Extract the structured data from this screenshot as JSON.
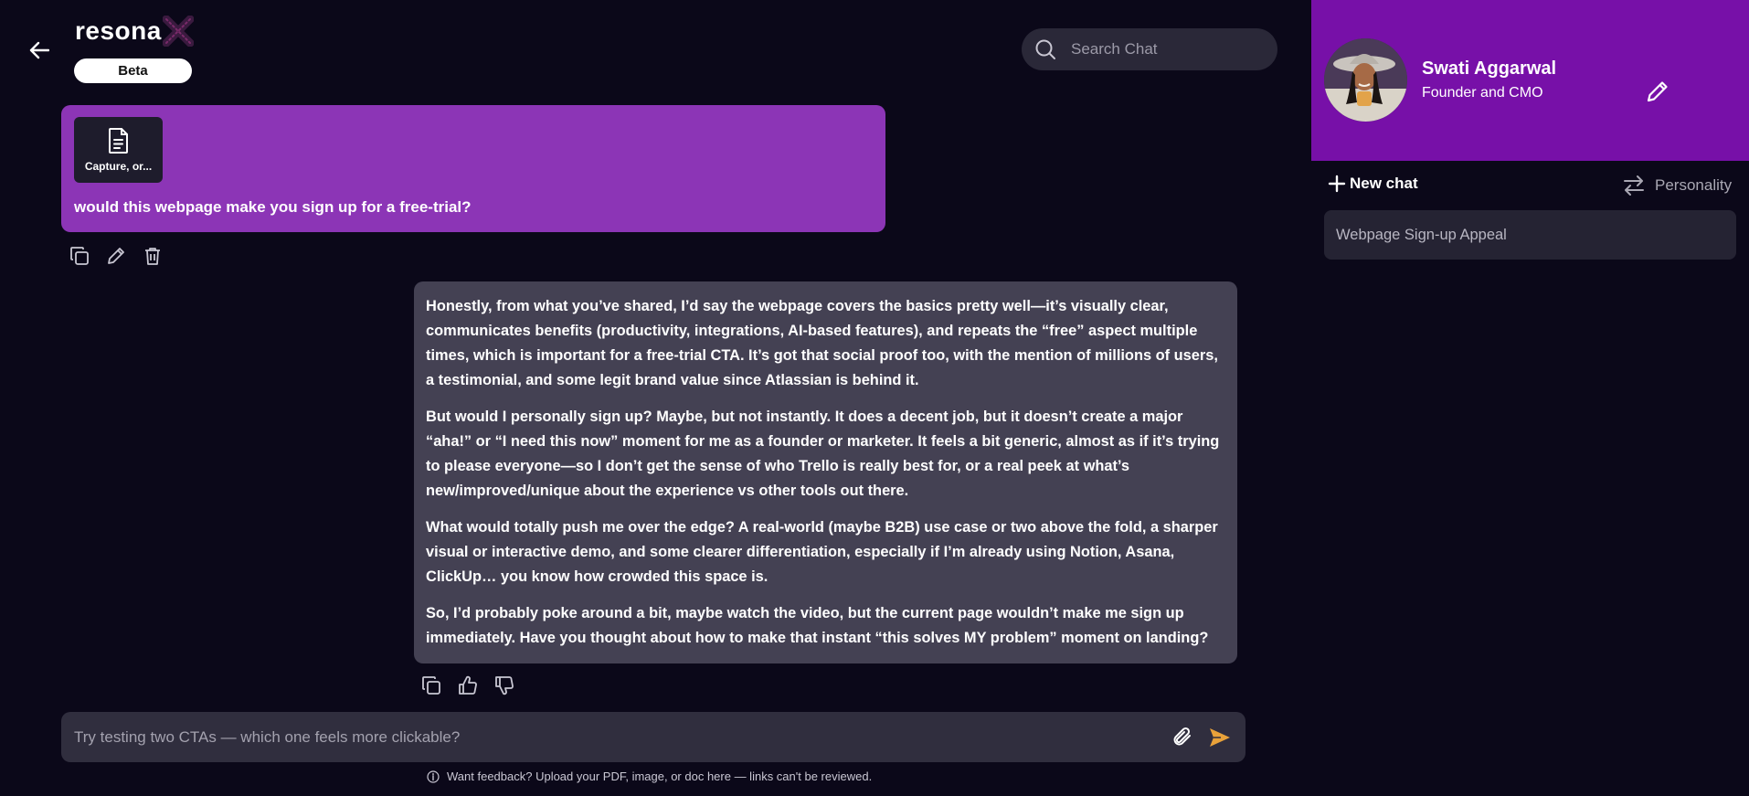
{
  "header": {
    "logo_text": "resona",
    "beta_label": "Beta",
    "search_placeholder": "Search Chat"
  },
  "user_message": {
    "attachment_name": "Capture, or...",
    "text": "would this webpage make you sign up for a free-trial?"
  },
  "ai_message": {
    "paragraphs": [
      "Honestly, from what you’ve shared, I’d say the webpage covers the basics pretty well—it’s visually clear, communicates benefits (productivity, integrations, AI-based features), and repeats the “free” aspect multiple times, which is important for a free-trial CTA. It’s got that social proof too, with the mention of millions of users, a testimonial, and some legit brand value since Atlassian is behind it.",
      "But would I personally sign up? Maybe, but not instantly. It does a decent job, but it doesn’t create a major “aha!” or “I need this now” moment for me as a founder or marketer. It feels a bit generic, almost as if it’s trying to please everyone—so I don’t get the sense of who Trello is really best for, or a real peek at what’s new/improved/unique about the experience vs other tools out there.",
      "What would totally push me over the edge? A real-world (maybe B2B) use case or two above the fold, a sharper visual or interactive demo, and some clearer differentiation, especially if I’m already using Notion, Asana, ClickUp… you know how crowded this space is.",
      "So, I’d probably poke around a bit, maybe watch the video, but the current page wouldn’t make me sign up immediately. Have you thought about how to make that instant “this solves MY problem” moment on landing?"
    ]
  },
  "composer": {
    "placeholder": "Try testing two CTAs — which one feels more clickable?"
  },
  "footnote": "Want feedback? Upload your PDF, image, or doc here — links can't be reviewed.",
  "sidebar": {
    "profile_name": "Swati Aggarwal",
    "profile_role": "Founder and CMO",
    "new_chat_label": "New chat",
    "personality_label": "Personality",
    "chats": [
      "Webpage Sign-up Appeal"
    ]
  },
  "colors": {
    "background": "#0b0819",
    "user_bubble": "#8c35b6",
    "ai_bubble": "#444153",
    "profile_panel": "#7710a8",
    "send_accent": "#e9a23a"
  },
  "icons": {
    "back": "arrow-left-icon",
    "search": "search-icon",
    "document": "document-icon",
    "copy": "copy-icon",
    "edit": "pencil-icon",
    "delete": "trash-icon",
    "thumbs_up": "thumbs-up-icon",
    "thumbs_down": "thumbs-down-icon",
    "attach": "paperclip-icon",
    "send": "send-icon",
    "info": "info-icon",
    "plus": "plus-icon",
    "swap": "swap-arrows-icon"
  }
}
